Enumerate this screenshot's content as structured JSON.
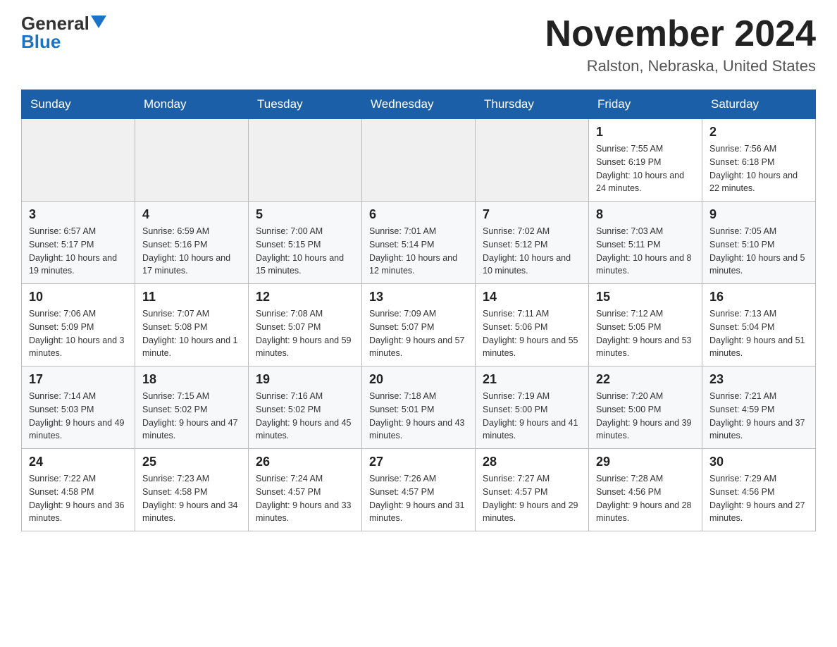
{
  "header": {
    "logo_general": "General",
    "logo_blue": "Blue",
    "month_title": "November 2024",
    "location": "Ralston, Nebraska, United States"
  },
  "calendar": {
    "days_of_week": [
      "Sunday",
      "Monday",
      "Tuesday",
      "Wednesday",
      "Thursday",
      "Friday",
      "Saturday"
    ],
    "weeks": [
      [
        {
          "day": "",
          "info": ""
        },
        {
          "day": "",
          "info": ""
        },
        {
          "day": "",
          "info": ""
        },
        {
          "day": "",
          "info": ""
        },
        {
          "day": "",
          "info": ""
        },
        {
          "day": "1",
          "info": "Sunrise: 7:55 AM\nSunset: 6:19 PM\nDaylight: 10 hours and 24 minutes."
        },
        {
          "day": "2",
          "info": "Sunrise: 7:56 AM\nSunset: 6:18 PM\nDaylight: 10 hours and 22 minutes."
        }
      ],
      [
        {
          "day": "3",
          "info": "Sunrise: 6:57 AM\nSunset: 5:17 PM\nDaylight: 10 hours and 19 minutes."
        },
        {
          "day": "4",
          "info": "Sunrise: 6:59 AM\nSunset: 5:16 PM\nDaylight: 10 hours and 17 minutes."
        },
        {
          "day": "5",
          "info": "Sunrise: 7:00 AM\nSunset: 5:15 PM\nDaylight: 10 hours and 15 minutes."
        },
        {
          "day": "6",
          "info": "Sunrise: 7:01 AM\nSunset: 5:14 PM\nDaylight: 10 hours and 12 minutes."
        },
        {
          "day": "7",
          "info": "Sunrise: 7:02 AM\nSunset: 5:12 PM\nDaylight: 10 hours and 10 minutes."
        },
        {
          "day": "8",
          "info": "Sunrise: 7:03 AM\nSunset: 5:11 PM\nDaylight: 10 hours and 8 minutes."
        },
        {
          "day": "9",
          "info": "Sunrise: 7:05 AM\nSunset: 5:10 PM\nDaylight: 10 hours and 5 minutes."
        }
      ],
      [
        {
          "day": "10",
          "info": "Sunrise: 7:06 AM\nSunset: 5:09 PM\nDaylight: 10 hours and 3 minutes."
        },
        {
          "day": "11",
          "info": "Sunrise: 7:07 AM\nSunset: 5:08 PM\nDaylight: 10 hours and 1 minute."
        },
        {
          "day": "12",
          "info": "Sunrise: 7:08 AM\nSunset: 5:07 PM\nDaylight: 9 hours and 59 minutes."
        },
        {
          "day": "13",
          "info": "Sunrise: 7:09 AM\nSunset: 5:07 PM\nDaylight: 9 hours and 57 minutes."
        },
        {
          "day": "14",
          "info": "Sunrise: 7:11 AM\nSunset: 5:06 PM\nDaylight: 9 hours and 55 minutes."
        },
        {
          "day": "15",
          "info": "Sunrise: 7:12 AM\nSunset: 5:05 PM\nDaylight: 9 hours and 53 minutes."
        },
        {
          "day": "16",
          "info": "Sunrise: 7:13 AM\nSunset: 5:04 PM\nDaylight: 9 hours and 51 minutes."
        }
      ],
      [
        {
          "day": "17",
          "info": "Sunrise: 7:14 AM\nSunset: 5:03 PM\nDaylight: 9 hours and 49 minutes."
        },
        {
          "day": "18",
          "info": "Sunrise: 7:15 AM\nSunset: 5:02 PM\nDaylight: 9 hours and 47 minutes."
        },
        {
          "day": "19",
          "info": "Sunrise: 7:16 AM\nSunset: 5:02 PM\nDaylight: 9 hours and 45 minutes."
        },
        {
          "day": "20",
          "info": "Sunrise: 7:18 AM\nSunset: 5:01 PM\nDaylight: 9 hours and 43 minutes."
        },
        {
          "day": "21",
          "info": "Sunrise: 7:19 AM\nSunset: 5:00 PM\nDaylight: 9 hours and 41 minutes."
        },
        {
          "day": "22",
          "info": "Sunrise: 7:20 AM\nSunset: 5:00 PM\nDaylight: 9 hours and 39 minutes."
        },
        {
          "day": "23",
          "info": "Sunrise: 7:21 AM\nSunset: 4:59 PM\nDaylight: 9 hours and 37 minutes."
        }
      ],
      [
        {
          "day": "24",
          "info": "Sunrise: 7:22 AM\nSunset: 4:58 PM\nDaylight: 9 hours and 36 minutes."
        },
        {
          "day": "25",
          "info": "Sunrise: 7:23 AM\nSunset: 4:58 PM\nDaylight: 9 hours and 34 minutes."
        },
        {
          "day": "26",
          "info": "Sunrise: 7:24 AM\nSunset: 4:57 PM\nDaylight: 9 hours and 33 minutes."
        },
        {
          "day": "27",
          "info": "Sunrise: 7:26 AM\nSunset: 4:57 PM\nDaylight: 9 hours and 31 minutes."
        },
        {
          "day": "28",
          "info": "Sunrise: 7:27 AM\nSunset: 4:57 PM\nDaylight: 9 hours and 29 minutes."
        },
        {
          "day": "29",
          "info": "Sunrise: 7:28 AM\nSunset: 4:56 PM\nDaylight: 9 hours and 28 minutes."
        },
        {
          "day": "30",
          "info": "Sunrise: 7:29 AM\nSunset: 4:56 PM\nDaylight: 9 hours and 27 minutes."
        }
      ]
    ]
  }
}
